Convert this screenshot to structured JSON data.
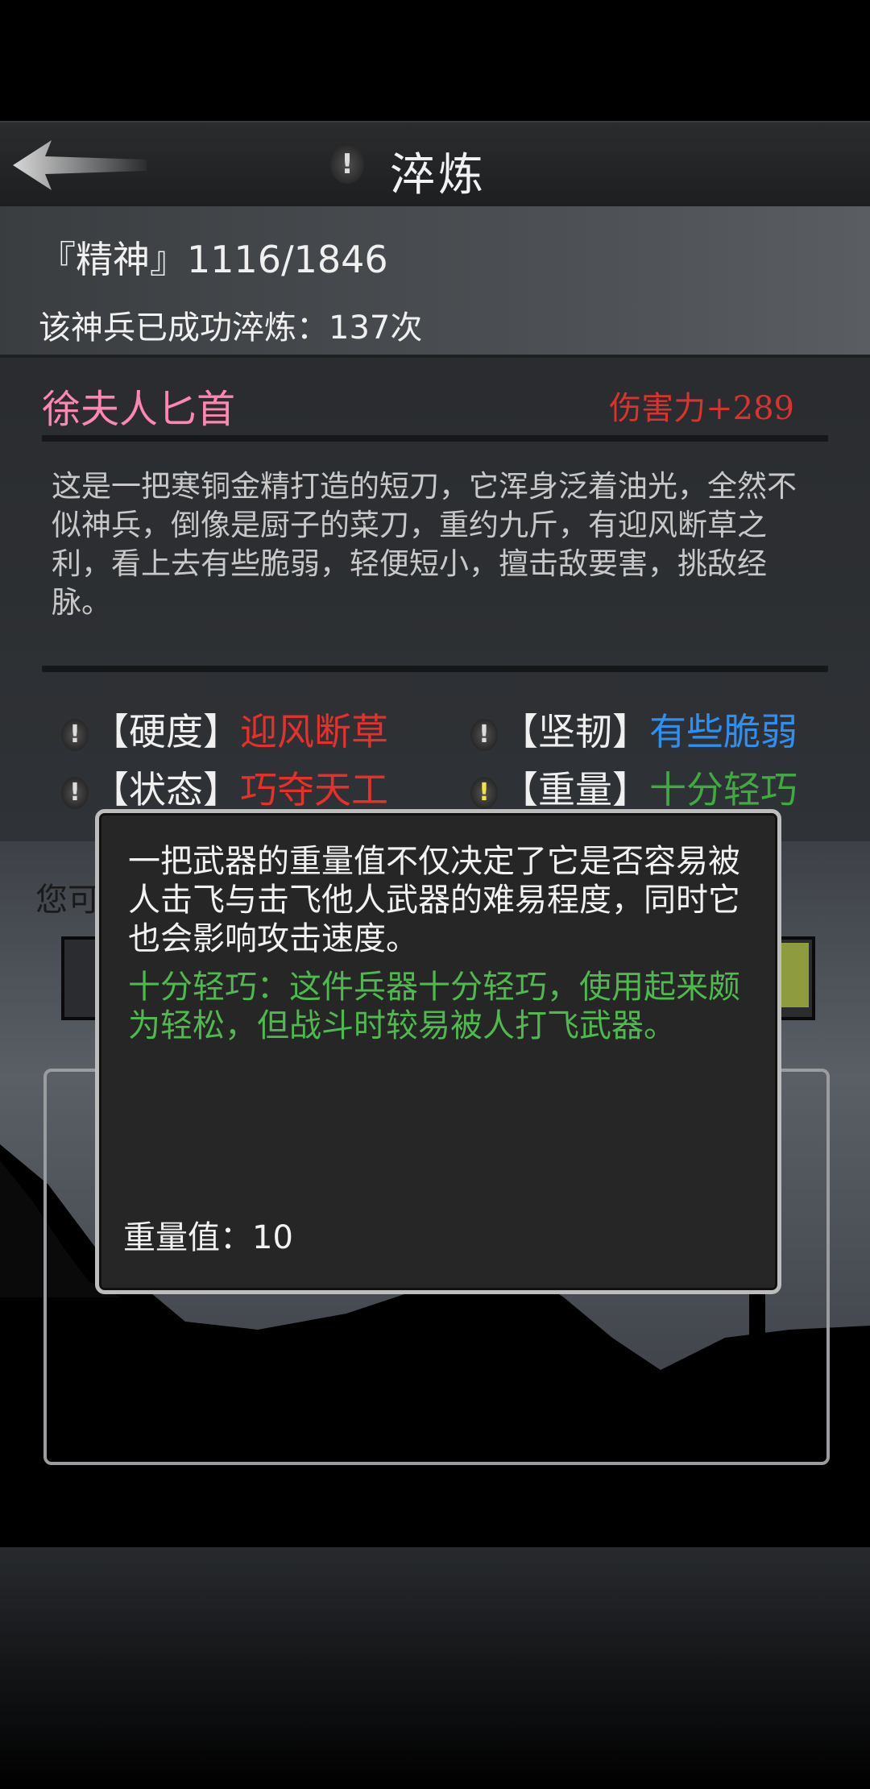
{
  "header": {
    "title": "淬炼",
    "title_icon": "!"
  },
  "stats": {
    "spirit": "『精神』1116/1846",
    "refine_count": "该神兵已成功淬炼：137次"
  },
  "weapon": {
    "name": "徐夫人匕首",
    "damage": "伤害力+289",
    "description": "这是一把寒铜金精打造的短刀，它浑身泛着油光，全然不似神兵，倒像是厨子的菜刀，重约九斤，有迎风断草之利，看上去有些脆弱，轻便短小，擅击敌要害，挑敌经脉。",
    "attributes": [
      {
        "label": "【硬度】",
        "value": "迎风断草",
        "color": "#e8302a"
      },
      {
        "label": "【坚韧】",
        "value": "有些脆弱",
        "color": "#2f8ff0"
      },
      {
        "label": "【状态】",
        "value": "巧夺天工",
        "color": "#e8302a"
      },
      {
        "label": "【重量】",
        "value": "十分轻巧",
        "color": "#3faa3f"
      }
    ]
  },
  "background": {
    "hint_text": "您可"
  },
  "tooltip": {
    "main_text": "一把武器的重量值不仅决定了它是否容易被人击飞与击飞他人武器的难易程度，同时它也会影响攻击速度。",
    "detail_text": "十分轻巧：这件兵器十分轻巧，使用起来颇为轻松，但战斗时较易被人打飞武器。",
    "weight_value": "重量值：10"
  },
  "colors": {
    "accent_pink": "#ff86b0",
    "damage_red": "#d8332e",
    "tip_green": "#4fb84f"
  }
}
